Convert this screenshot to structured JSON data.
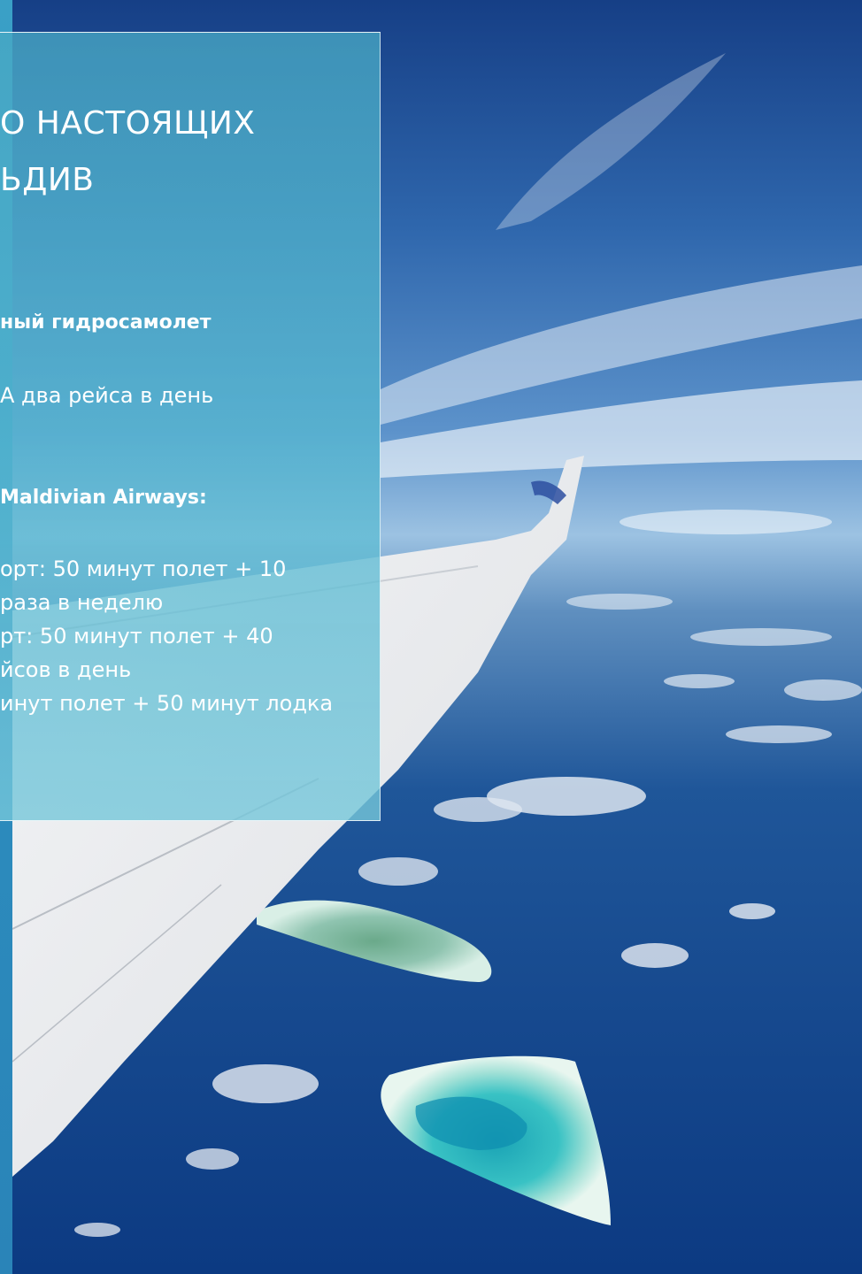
{
  "colors": {
    "sky_top": "#1b4f93",
    "sky_mid": "#3d78bb",
    "ocean": "#0f3f86",
    "panel": "#5ab6cf",
    "text": "#ffffff"
  },
  "panel": {
    "title_lines": [
      "О НАСТОЯЩИХ",
      "ЬДИВ"
    ],
    "heading_1": "ный гидросамолет",
    "line_1": "А  два рейса в день",
    "heading_2": "Maldivian Airways:",
    "schedule": [
      "орт: 50 минут полет + 10",
      "раза в неделю",
      "рт: 50 минут полет + 40",
      "йсов в день",
      "инут полет + 50 минут лодка"
    ]
  }
}
